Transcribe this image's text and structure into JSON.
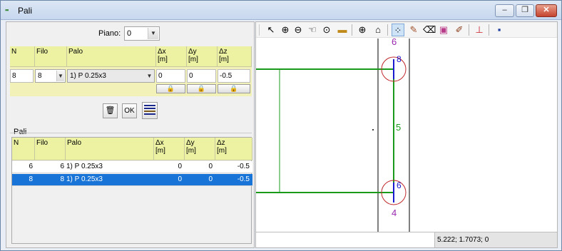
{
  "window": {
    "title": "Pali",
    "icon": "app-icon",
    "buttons": {
      "minimize": "–",
      "restore": "❐",
      "close": "✕"
    }
  },
  "piano": {
    "label": "Piano:",
    "value": "0"
  },
  "editor": {
    "headers": {
      "n": "N",
      "filo": "Filo",
      "palo": "Palo",
      "dx": "Δx\n[m]",
      "dy": "Δy\n[m]",
      "dz": "Δz\n[m]"
    },
    "row": {
      "n": "8",
      "filo": "8",
      "palo": "1) P 0.25x3",
      "dx": "0",
      "dy": "0",
      "dz": "-0.5"
    }
  },
  "actions": {
    "delete_icon": "trash-icon",
    "ok_label": "OK",
    "list_icon": "list-icon"
  },
  "list": {
    "group_label": "Pali",
    "headers": {
      "n": "N",
      "filo": "Filo",
      "palo": "Palo",
      "dx": "Δx\n[m]",
      "dy": "Δy\n[m]",
      "dz": "Δz\n[m]"
    },
    "rows": [
      {
        "n": "6",
        "filo": "6",
        "palo": "1) P 0.25x3",
        "dx": "0",
        "dy": "0",
        "dz": "-0.5",
        "selected": false
      },
      {
        "n": "8",
        "filo": "8",
        "palo": "1) P 0.25x3",
        "dx": "0",
        "dy": "0",
        "dz": "-0.5",
        "selected": true
      }
    ]
  },
  "drawing": {
    "labels": {
      "top_node": "6",
      "top_pile": "8",
      "wall": "5",
      "bottom_pile": "6",
      "bottom_node": "4"
    }
  },
  "status": {
    "coords": "5.222; 1.7073; 0"
  },
  "colors": {
    "selection": "#1874d6",
    "header": "#ecf2a2",
    "wall": "#1a9a1a",
    "pile_circle": "#c0282d",
    "label_purple": "#9a2ab0"
  }
}
